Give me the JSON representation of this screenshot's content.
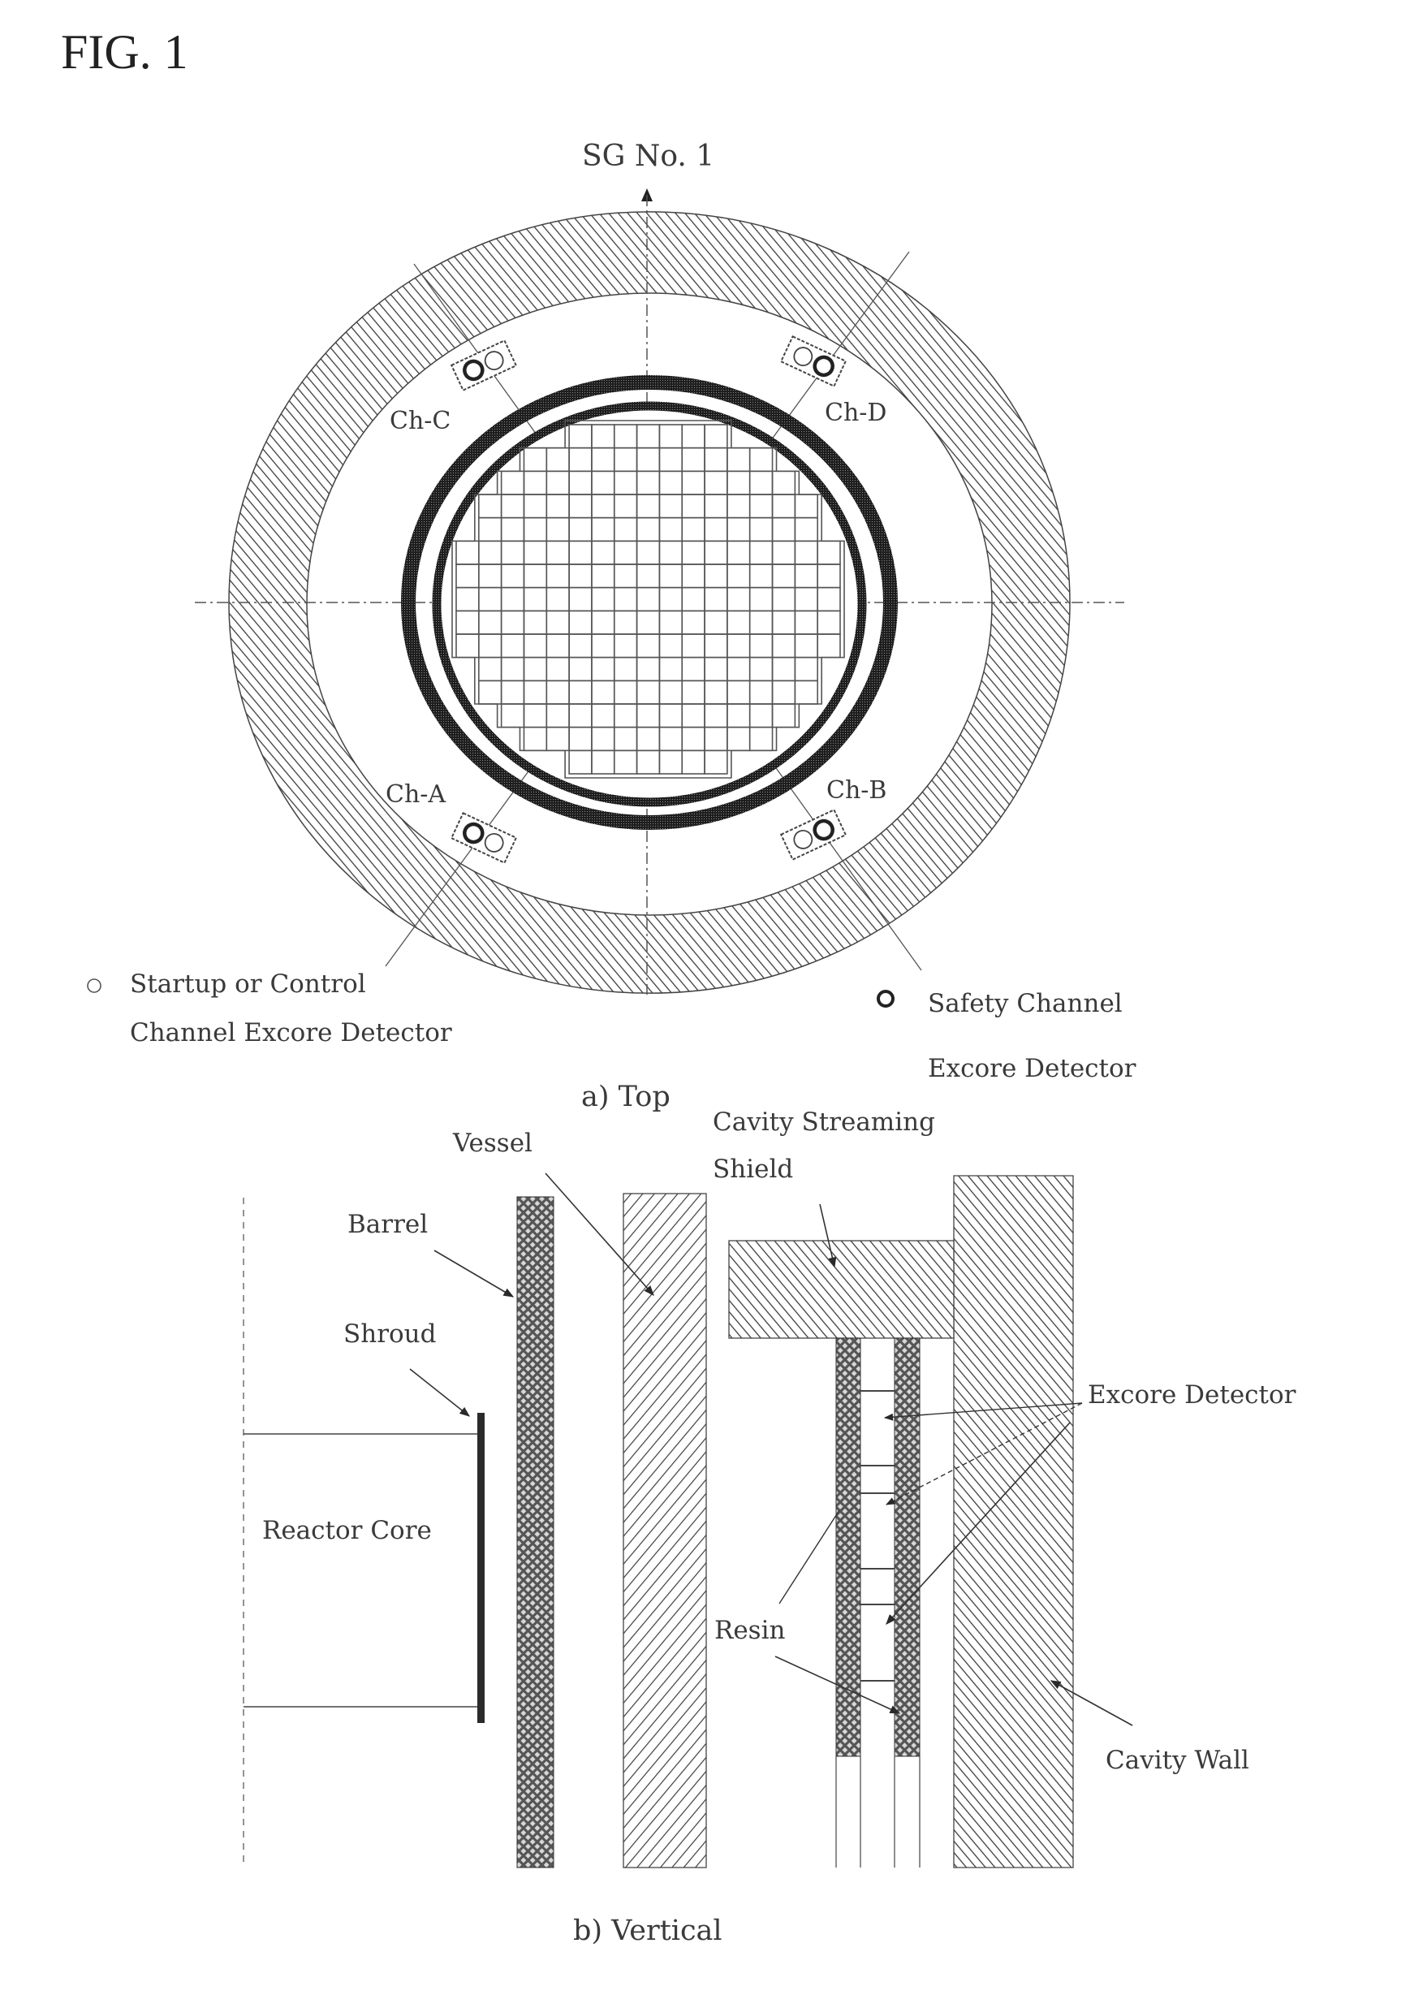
{
  "figure": {
    "title": "FIG. 1"
  },
  "top_view": {
    "reference_label": "SG No. 1",
    "caption": "a) Top",
    "channels": [
      {
        "id": "ch-c",
        "label": "Ch-C"
      },
      {
        "id": "ch-d",
        "label": "Ch-D"
      },
      {
        "id": "ch-a",
        "label": "Ch-A"
      },
      {
        "id": "ch-b",
        "label": "Ch-B"
      }
    ],
    "legend": {
      "startup_line1": "Startup or Control",
      "startup_line2": "Channel Excore Detector",
      "safety_line1": "Safety Channel",
      "safety_line2": "Excore Detector"
    }
  },
  "vertical_view": {
    "caption": "b) Vertical",
    "labels": {
      "vessel": "Vessel",
      "cavity_streaming_line1": "Cavity Streaming",
      "cavity_streaming_line2": "Shield",
      "barrel": "Barrel",
      "shroud": "Shroud",
      "reactor_core": "Reactor Core",
      "excore_detector": "Excore Detector",
      "resin": "Resin",
      "cavity_wall": "Cavity Wall"
    }
  },
  "colors": {
    "ink": "#2a2a2a",
    "hatch": "#4a4a4a",
    "background": "#ffffff"
  }
}
